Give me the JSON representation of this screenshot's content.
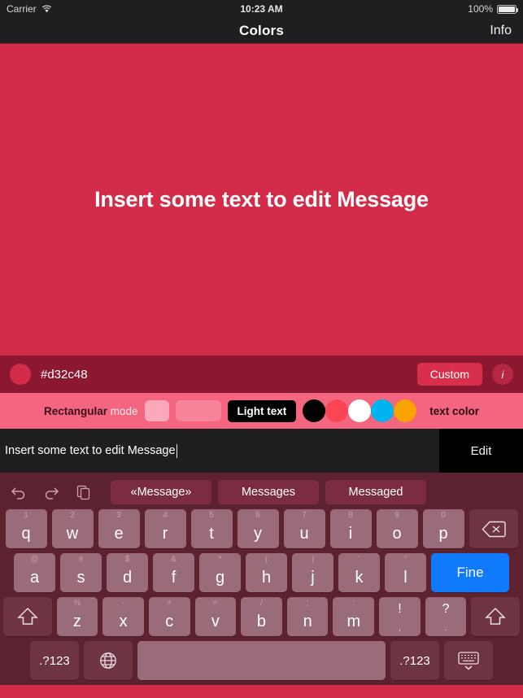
{
  "status_bar": {
    "carrier": "Carrier",
    "wifi_icon": "wifi-icon",
    "time": "10:23 AM",
    "battery_percent": "100%"
  },
  "nav_bar": {
    "title": "Colors",
    "right_button": "Info"
  },
  "canvas": {
    "text": "Insert some text to edit Message",
    "background_color": "#d32c48",
    "text_color": "#ffffff"
  },
  "hex_bar": {
    "swatch_color": "#d32c48",
    "hex_value": "#d32c48",
    "custom_button": "Custom",
    "info_button": "i",
    "background_color": "#8c1730"
  },
  "options_bar": {
    "mode_label_strong": "Rectangular",
    "mode_label_light": "mode",
    "light_text_button": "Light text",
    "text_color_label": "text color",
    "color_dots": [
      {
        "name": "black",
        "hex": "#000000"
      },
      {
        "name": "red",
        "hex": "#fb4454"
      },
      {
        "name": "white",
        "hex": "#ffffff"
      },
      {
        "name": "cyan",
        "hex": "#00b4ef"
      },
      {
        "name": "orange",
        "hex": "#f9a300"
      }
    ],
    "background_color": "#f4657f"
  },
  "text_field": {
    "value": "Insert some text to edit Message",
    "placeholder": "Insert some text",
    "edit_button": "Edit"
  },
  "keyboard": {
    "tools": [
      "undo-icon",
      "redo-icon",
      "paste-icon"
    ],
    "suggestions": [
      "«Message»",
      "Messages",
      "Messaged"
    ],
    "row1": [
      {
        "sup": "1",
        "main": "q"
      },
      {
        "sup": "2",
        "main": "w"
      },
      {
        "sup": "3",
        "main": "e"
      },
      {
        "sup": "4",
        "main": "r"
      },
      {
        "sup": "5",
        "main": "t"
      },
      {
        "sup": "6",
        "main": "y"
      },
      {
        "sup": "7",
        "main": "u"
      },
      {
        "sup": "8",
        "main": "i"
      },
      {
        "sup": "9",
        "main": "o"
      },
      {
        "sup": "0",
        "main": "p"
      }
    ],
    "backspace": "backspace-icon",
    "row2": [
      {
        "sup": "@",
        "main": "a"
      },
      {
        "sup": "#",
        "main": "s"
      },
      {
        "sup": "$",
        "main": "d"
      },
      {
        "sup": "&",
        "main": "f"
      },
      {
        "sup": "*",
        "main": "g"
      },
      {
        "sup": "(",
        "main": "h"
      },
      {
        "sup": ")",
        "main": "j"
      },
      {
        "sup": "'",
        "main": "k"
      },
      {
        "sup": "“",
        "main": "l"
      }
    ],
    "return_key": "Fine",
    "row3": [
      {
        "sup": "%",
        "main": "z"
      },
      {
        "sup": "-",
        "main": "x"
      },
      {
        "sup": "+",
        "main": "c"
      },
      {
        "sup": "=",
        "main": "v"
      },
      {
        "sup": "/",
        "main": "b"
      },
      {
        "sup": ";",
        "main": "n"
      },
      {
        "sup": ":",
        "main": "m"
      }
    ],
    "punct_keys": [
      {
        "top": "!",
        "bottom": ","
      },
      {
        "top": "?",
        "bottom": "."
      }
    ],
    "shift_left": "shift-icon",
    "shift_right": "shift-icon",
    "numeric_left": ".?123",
    "globe": "globe-icon",
    "space": "",
    "numeric_right": ".?123",
    "dismiss": "dismiss-keyboard-icon",
    "background_color": "#5d2230",
    "key_color": "#9a6b78",
    "return_color": "#107afd"
  }
}
